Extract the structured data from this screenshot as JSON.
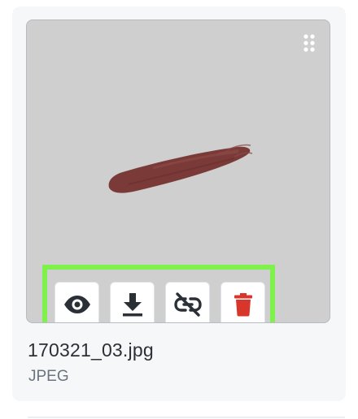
{
  "file": {
    "name": "170321_03.jpg",
    "type": "JPEG"
  },
  "actions": [
    {
      "icon": "eye-icon",
      "label": "Preview"
    },
    {
      "icon": "download-icon",
      "label": "Download"
    },
    {
      "icon": "unlink-icon",
      "label": "Unlink"
    },
    {
      "icon": "trash-icon",
      "label": "Delete"
    }
  ],
  "colors": {
    "card_background": "#f6f7f9",
    "thumbnail_background": "#cfcfcf",
    "highlight_border": "#7ef14a",
    "icon_dark": "#2b2f36",
    "delete_red": "#d9362b",
    "swatch_color": "#7a3a38"
  }
}
